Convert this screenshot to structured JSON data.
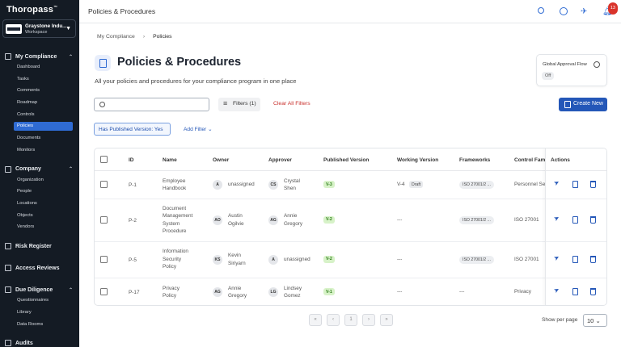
{
  "sidebar": {
    "logo": "Thoropass",
    "workspace": {
      "name": "Graystone Indu...",
      "sub": "Workspace"
    },
    "sections": [
      {
        "label": "My Compliance",
        "items": [
          "Dashboard",
          "Tasks",
          "Comments",
          "Roadmap",
          "Controls",
          "Policies",
          "Documents",
          "Monitors"
        ]
      },
      {
        "label": "Company",
        "items": [
          "Organization",
          "People",
          "Locations",
          "Objects",
          "Vendors"
        ]
      },
      {
        "label": "Risk Register",
        "items": []
      },
      {
        "label": "Access Reviews",
        "items": []
      },
      {
        "label": "Due Diligence",
        "items": [
          "Questionnaires",
          "Library",
          "Data Rooms"
        ]
      },
      {
        "label": "Audits",
        "items": []
      }
    ],
    "active_item": "Policies"
  },
  "topbar": {
    "title": "Policies & Procedures",
    "notif_count": "13",
    "icons": [
      "search-icon",
      "help-icon",
      "telescope-icon",
      "bell-icon"
    ]
  },
  "breadcrumb": {
    "parent": "My Compliance",
    "current": "Policies"
  },
  "page": {
    "title": "Policies & Procedures",
    "description": "All your policies and procedures for your compliance program in one place"
  },
  "approval": {
    "label": "Global Approval Flow",
    "status": "Off"
  },
  "toolbar": {
    "search_placeholder": "",
    "filters_label": "Filters (1)",
    "clear_label": "Clear All Filters",
    "new_label": "Create New"
  },
  "filter_chip": "Has Published Version: Yes",
  "add_filter": "Add Filter",
  "table": {
    "headers": [
      "ID",
      "Name",
      "Owner",
      "Approver",
      "Published Version",
      "Working Version",
      "Frameworks",
      "Control Fami",
      "Actions"
    ],
    "rows": [
      {
        "id": "P-1",
        "name": [
          "Employee",
          "Handbook"
        ],
        "owner_init": "A",
        "owner": [
          "unassigned"
        ],
        "approver_init": "CS",
        "approver": [
          "Crystal",
          "Shen"
        ],
        "published": "V-3",
        "working": "V-4",
        "working_badge": "Draft",
        "framework": "ISO 27001/2 ...",
        "control": "Personnel Se"
      },
      {
        "id": "P-2",
        "name": [
          "Document",
          "Management",
          "System",
          "Procedure"
        ],
        "owner_init": "AO",
        "owner": [
          "Austin",
          "Ogilvie"
        ],
        "approver_init": "AG",
        "approver": [
          "Annie",
          "Gregory"
        ],
        "published": "V-2",
        "working": "---",
        "working_badge": "",
        "framework": "ISO 27001/2 ...",
        "control": "ISO 27001"
      },
      {
        "id": "P-5",
        "name": [
          "Information",
          "Security",
          "Policy"
        ],
        "owner_init": "KS",
        "owner": [
          "Kevin",
          "Siriyarn"
        ],
        "approver_init": "A",
        "approver": [
          "unassigned"
        ],
        "published": "V-2",
        "working": "---",
        "working_badge": "",
        "framework": "ISO 27001/2 ...",
        "control": "ISO 27001"
      },
      {
        "id": "P-17",
        "name": [
          "Privacy",
          "Policy"
        ],
        "owner_init": "AG",
        "owner": [
          "Annie",
          "Gregory"
        ],
        "approver_init": "LG",
        "approver": [
          "Lindsey",
          "Gomez"
        ],
        "published": "V-1",
        "working": "---",
        "working_badge": "",
        "framework": "---",
        "control": "Privacy"
      }
    ]
  },
  "pagination": {
    "buttons": [
      "«",
      "‹",
      "1",
      "›",
      "»"
    ],
    "per_page_label": "Show per page",
    "per_page_value": "10"
  },
  "colors": {
    "sidebar_bg": "#141b24",
    "accent": "#2457b8",
    "active_nav": "#2f6bd3",
    "danger": "#c9302c",
    "badge_green": "#d7f2c8"
  }
}
